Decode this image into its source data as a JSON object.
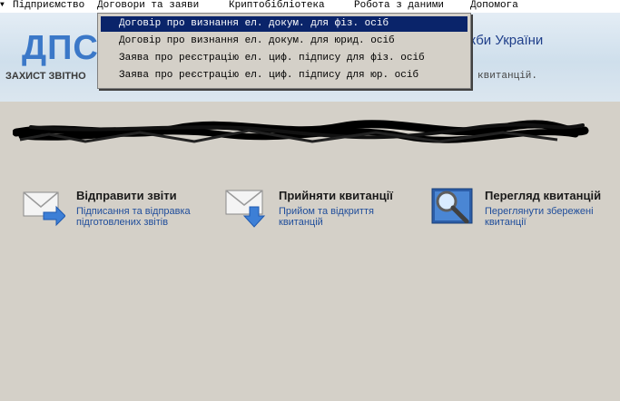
{
  "menubar": {
    "items": [
      {
        "label": "Підприємство"
      },
      {
        "label": "Договори та заяви"
      },
      {
        "label": "Криптобібліотека"
      },
      {
        "label": "Робота з даними"
      },
      {
        "label": "Допомога"
      }
    ]
  },
  "banner": {
    "logo": "ДПС",
    "subtitle": "ЗАХИСТ ЗВІТНО",
    "right_title": "жби України",
    "right_text": "квитанцій."
  },
  "dropdown": {
    "items": [
      {
        "label": "Договір про визнання ел. докум. для фіз. осіб",
        "selected": true
      },
      {
        "label": "Договір про визнання ел. докум. для юрид. осіб",
        "selected": false
      },
      {
        "label": "Заява про реєстрацію ел. циф. підпису для фіз. осіб",
        "selected": false
      },
      {
        "label": "Заява про реєстрацію ел. циф. підпису для юр. осіб",
        "selected": false
      }
    ]
  },
  "actions": [
    {
      "title": "Відправити звіти",
      "desc_line1": "Підписання та відправка",
      "desc_line2": "підготовлених звітів",
      "icon": "envelope-send-icon"
    },
    {
      "title": "Прийняти квитанції",
      "desc_line1": "Прийом та відкриття",
      "desc_line2": "квитанцій",
      "icon": "envelope-receive-icon"
    },
    {
      "title": "Перегляд квитанцій",
      "desc_line1": "Переглянути збережені",
      "desc_line2": "квитанції",
      "icon": "magnifier-view-icon"
    }
  ],
  "colors": {
    "background": "#d4d0c8",
    "menu_highlight": "#0a246a",
    "link_blue": "#1f4d9b",
    "logo_blue": "#3b78c8"
  }
}
